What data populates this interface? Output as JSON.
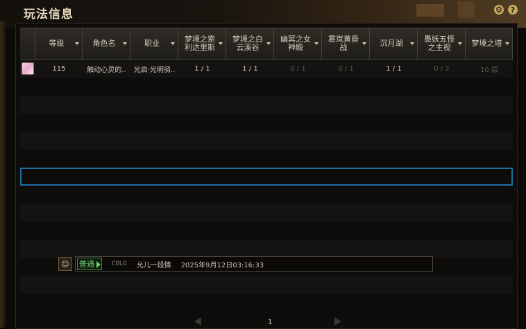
{
  "window": {
    "title": "玩法信息"
  },
  "toolbar": {
    "settings_icon": "gear-icon",
    "help_icon": "help-icon",
    "help_glyph": "?"
  },
  "table": {
    "columns": [
      {
        "label": "",
        "sortable": false
      },
      {
        "label": "等级",
        "sortable": true
      },
      {
        "label": "角色名",
        "sortable": true
      },
      {
        "label": "职业",
        "sortable": true
      },
      {
        "label": "梦境之索利达里斯",
        "sortable": true
      },
      {
        "label": "梦境之白云溪谷",
        "sortable": true
      },
      {
        "label": "幽冥之女神殿",
        "sortable": true
      },
      {
        "label": "雾岚黄昏战",
        "sortable": true
      },
      {
        "label": "沉月湖",
        "sortable": true
      },
      {
        "label": "愚妖五怪之主视",
        "sortable": true
      },
      {
        "label": "梦境之塔",
        "sortable": true
      }
    ],
    "rows": [
      {
        "avatar": "character-avatar",
        "level": "115",
        "name": "触动心灵的..",
        "job": "光启·光明骑..",
        "c1": "1 / 1",
        "c2": "1 / 1",
        "c3": "0 / 1",
        "c4": "0 / 1",
        "c5": "1 / 1",
        "c6": "0 / 2",
        "c7": "10 层"
      }
    ],
    "empty_rows": 12,
    "selected_empty_row": 6
  },
  "chat": {
    "icon": "emoji-icon",
    "channel_tag": "普通",
    "server": "COLG",
    "message": "允儿一段情",
    "timestamp": "2025年9月12日03:16:33"
  },
  "pager": {
    "page": "1"
  },
  "colors": {
    "selected_border": "#1d6f9c",
    "chat_tag": "#6cd06c",
    "title": "#e8dcc0"
  }
}
